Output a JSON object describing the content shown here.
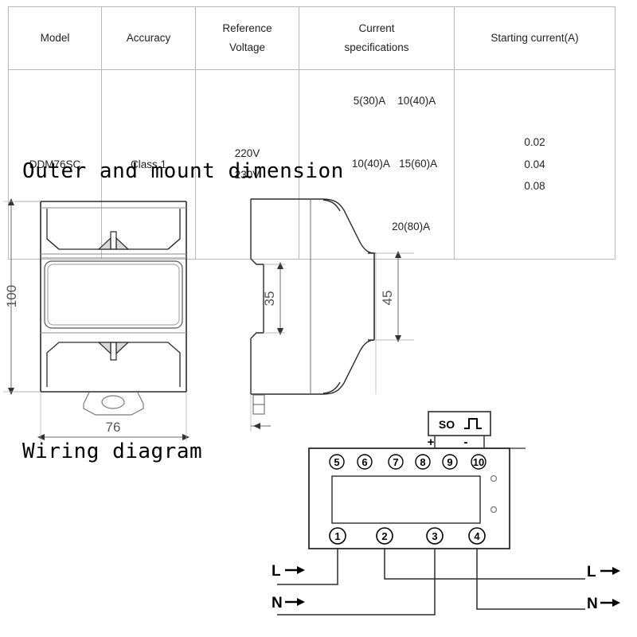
{
  "spec_table": {
    "headers": [
      {
        "id": "model",
        "lines": [
          "Model"
        ]
      },
      {
        "id": "accuracy",
        "lines": [
          "Accuracy"
        ]
      },
      {
        "id": "voltage",
        "lines": [
          "Reference",
          "Voltage"
        ]
      },
      {
        "id": "current",
        "lines": [
          "Current",
          "specifications"
        ]
      },
      {
        "id": "starting",
        "lines": [
          "Starting current(A)"
        ]
      }
    ],
    "row": {
      "model": "DDM76SC",
      "accuracy": "Class 1",
      "reference_voltage": [
        "220V",
        "230V"
      ],
      "current_specifications": [
        [
          "5(30)A",
          "10(40)A"
        ],
        [
          "10(40)A",
          "15(60)A"
        ],
        [
          "",
          "20(80)A"
        ]
      ],
      "starting_current": [
        "0.02",
        "0.04",
        "0.08"
      ]
    }
  },
  "headings": {
    "outer_dimension": "Outer and mount dimension",
    "wiring_diagram": "Wiring diagram"
  },
  "front_view": {
    "height_dimension": "100",
    "width_dimension": "76"
  },
  "side_view": {
    "rail_dimension": "35",
    "depth_dimension": "45"
  },
  "wiring": {
    "pulse_output": {
      "label": "SO",
      "positive": "+",
      "negative": "-"
    },
    "top_terminals": [
      "5",
      "6",
      "7",
      "8",
      "9",
      "10"
    ],
    "bottom_terminals": [
      "1",
      "2",
      "3",
      "4"
    ],
    "input_labels": {
      "line": "L",
      "neutral": "N"
    },
    "output_labels": {
      "line": "L",
      "neutral": "N"
    }
  },
  "colors": {
    "line": "#3a3a3a",
    "light_line": "#8a8a8a",
    "table_border": "#b9b9b9",
    "text": "#1a1a1a"
  }
}
